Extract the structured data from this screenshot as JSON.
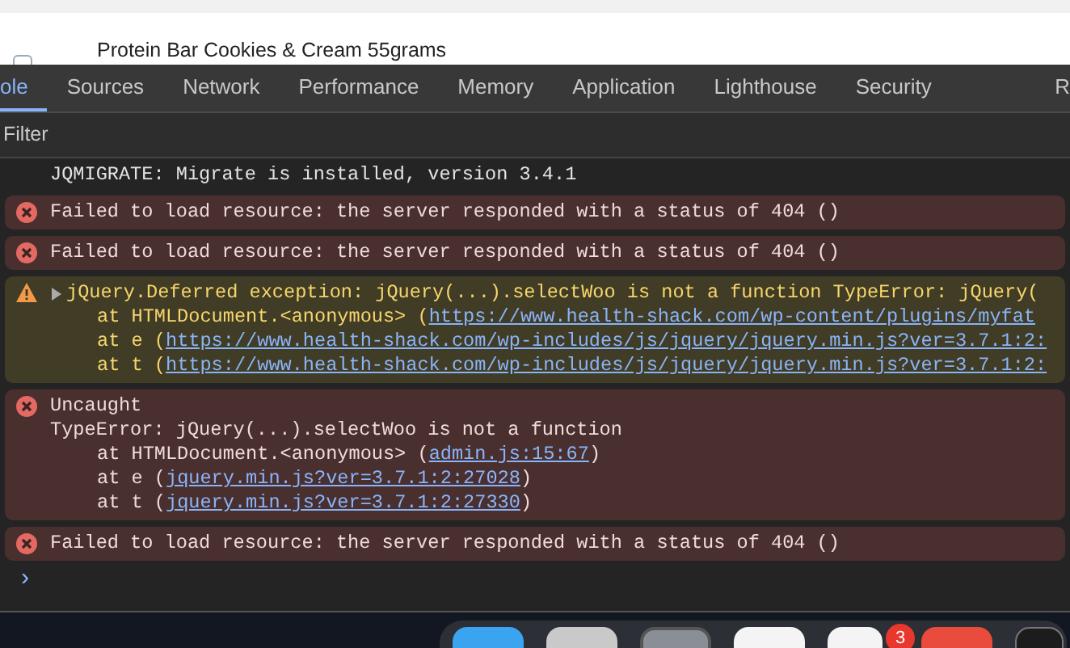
{
  "page": {
    "product_title": "Protein Bar Cookies & Cream 55grams"
  },
  "tabs": [
    {
      "label": "ole",
      "selected": true
    },
    {
      "label": "Sources",
      "selected": false
    },
    {
      "label": "Network",
      "selected": false
    },
    {
      "label": "Performance",
      "selected": false
    },
    {
      "label": "Memory",
      "selected": false
    },
    {
      "label": "Application",
      "selected": false
    },
    {
      "label": "Lighthouse",
      "selected": false
    },
    {
      "label": "Security",
      "selected": false
    },
    {
      "label": "R",
      "selected": false
    }
  ],
  "filter": {
    "placeholder": "Filter"
  },
  "messages": [
    {
      "kind": "log",
      "text": "JQMIGRATE: Migrate is installed, version 3.4.1"
    },
    {
      "kind": "error",
      "text": "Failed to load resource: the server responded with a status of 404 ()"
    },
    {
      "kind": "error",
      "text": "Failed to load resource: the server responded with a status of 404 ()"
    },
    {
      "kind": "warning",
      "expanded": false,
      "text": "jQuery.Deferred exception: jQuery(...).selectWoo is not a function TypeError: jQuery(",
      "stack": [
        {
          "prefix": "at HTMLDocument.<anonymous> (",
          "link": "https://www.health-shack.com/wp-content/plugins/myfat"
        },
        {
          "prefix": "at e (",
          "link": "https://www.health-shack.com/wp-includes/js/jquery/jquery.min.js?ver=3.7.1:2:"
        },
        {
          "prefix": "at t (",
          "link": "https://www.health-shack.com/wp-includes/js/jquery/jquery.min.js?ver=3.7.1:2:"
        }
      ]
    },
    {
      "kind": "error",
      "text": "Uncaught",
      "detail": "TypeError: jQuery(...).selectWoo is not a function",
      "stack": [
        {
          "prefix": "at HTMLDocument.<anonymous> (",
          "link": "admin.js:15:67",
          "suffix": ")"
        },
        {
          "prefix": "at e (",
          "link": "jquery.min.js?ver=3.7.1:2:27028",
          "suffix": ")"
        },
        {
          "prefix": "at t (",
          "link": "jquery.min.js?ver=3.7.1:2:27330",
          "suffix": ")"
        }
      ]
    },
    {
      "kind": "error",
      "text": "Failed to load resource: the server responded with a status of 404 ()"
    }
  ],
  "prompt": {
    "symbol": "›"
  },
  "dock": {
    "badge": "3"
  }
}
